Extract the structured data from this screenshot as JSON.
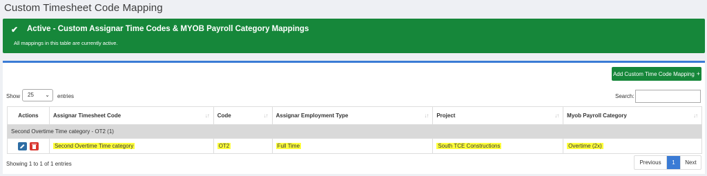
{
  "page": {
    "title": "Custom Timesheet Code Mapping"
  },
  "alert": {
    "title": "Active - Custom Assignar Time Codes & MYOB Payroll Category Mappings",
    "body": "All mappings in this table are currently active.",
    "color": "#16873a"
  },
  "toolbar": {
    "add_label": "Add Custom Time Code Mapping",
    "add_icon": "plus-icon"
  },
  "length": {
    "show_label": "Show",
    "selected": "25",
    "entries_label": "entries"
  },
  "search": {
    "label": "Search:",
    "value": ""
  },
  "table": {
    "headers": [
      "Actions",
      "Assignar Timesheet Code",
      "Code",
      "Assignar Employment Type",
      "Project",
      "Myob Payroll Category"
    ],
    "group_label": "Second Overtime Time category - OT2 (1)",
    "rows": [
      {
        "timesheet_code": "Second Overtime Time category",
        "code": "OT2",
        "employment_type": "Full Time",
        "project": "South TCE Constructions",
        "payroll_category": "Overtime (2x)"
      }
    ]
  },
  "info": "Showing 1 to 1 of 1 entries",
  "pagination": {
    "previous": "Previous",
    "current": "1",
    "next": "Next"
  },
  "colors": {
    "primary": "#3a7bd5",
    "success": "#16873a",
    "danger": "#d9362f",
    "highlight": "#ffff3c"
  }
}
